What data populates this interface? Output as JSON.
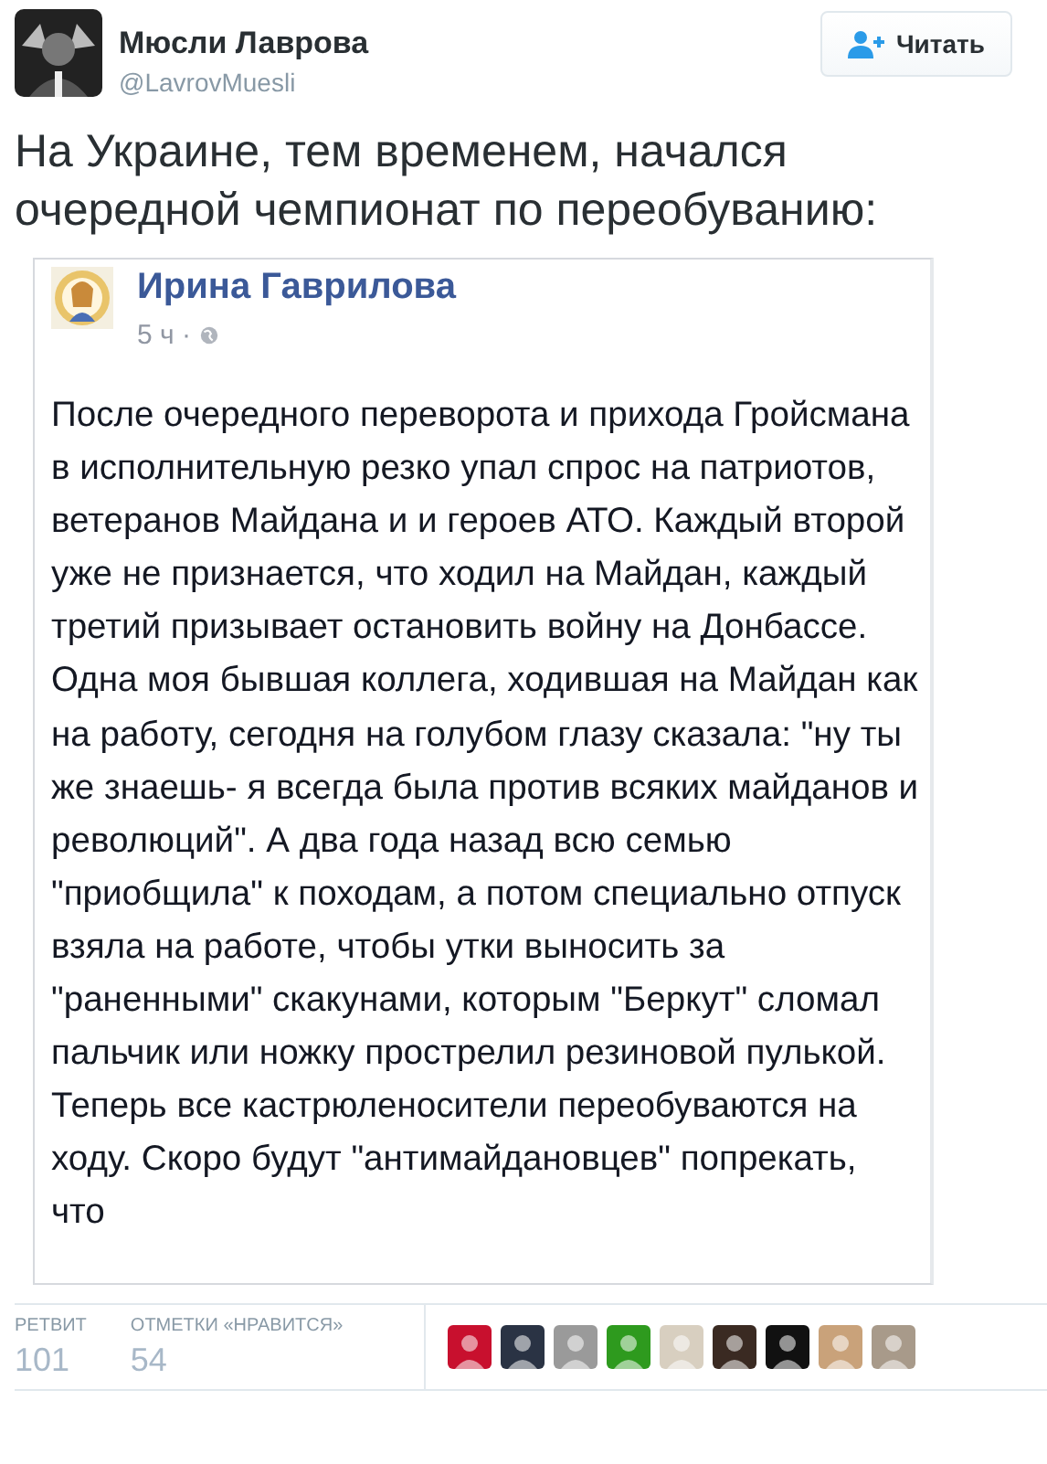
{
  "author": {
    "name": "Мюсли Лаврова",
    "handle": "@LavrovMuesli"
  },
  "follow_button": {
    "label": "Читать"
  },
  "tweet_text": "На Украине, тем временем, начался очередной чемпионат по переобуванию:",
  "embedded_post": {
    "author": "Ирина Гаврилова",
    "time": "5 ч ·",
    "text": "После очередного переворота и прихода Гройсмана в исполнительную резко упал спрос на патриотов, ветеранов Майдана и и героев АТО. Каждый второй уже не признается, что ходил на Майдан, каждый третий призывает остановить войну на Донбассе. Одна моя бывшая коллега, ходившая на Майдан как на работу, сегодня на голубом глазу сказала: \"ну ты же знаешь- я всегда была против всяких майданов и революций\". А два года назад всю семью \"приобщила\" к походам, а потом специально отпуск взяла на работе, чтобы утки выносить за \"раненными\" скакунами, которым \"Беркут\" сломал пальчик или ножку прострелил резиновой пулькой. Теперь все кастрюленосители переобуваются на ходу. Скоро будут \"антимайдановцев\" попрекать, что"
  },
  "stats": [
    {
      "label": "РЕТВИТ",
      "value": "101"
    },
    {
      "label": "ОТМЕТКИ «НРАВИТСЯ»",
      "value": "54"
    }
  ],
  "liker_avatars": [
    {
      "color": "#c8102e"
    },
    {
      "color": "#2a3344"
    },
    {
      "color": "#9a9a9a"
    },
    {
      "color": "#2e9a1e"
    },
    {
      "color": "#d8cfc0"
    },
    {
      "color": "#3a2a22"
    },
    {
      "color": "#111111"
    },
    {
      "color": "#c9a27a"
    },
    {
      "color": "#a89a8a"
    }
  ]
}
